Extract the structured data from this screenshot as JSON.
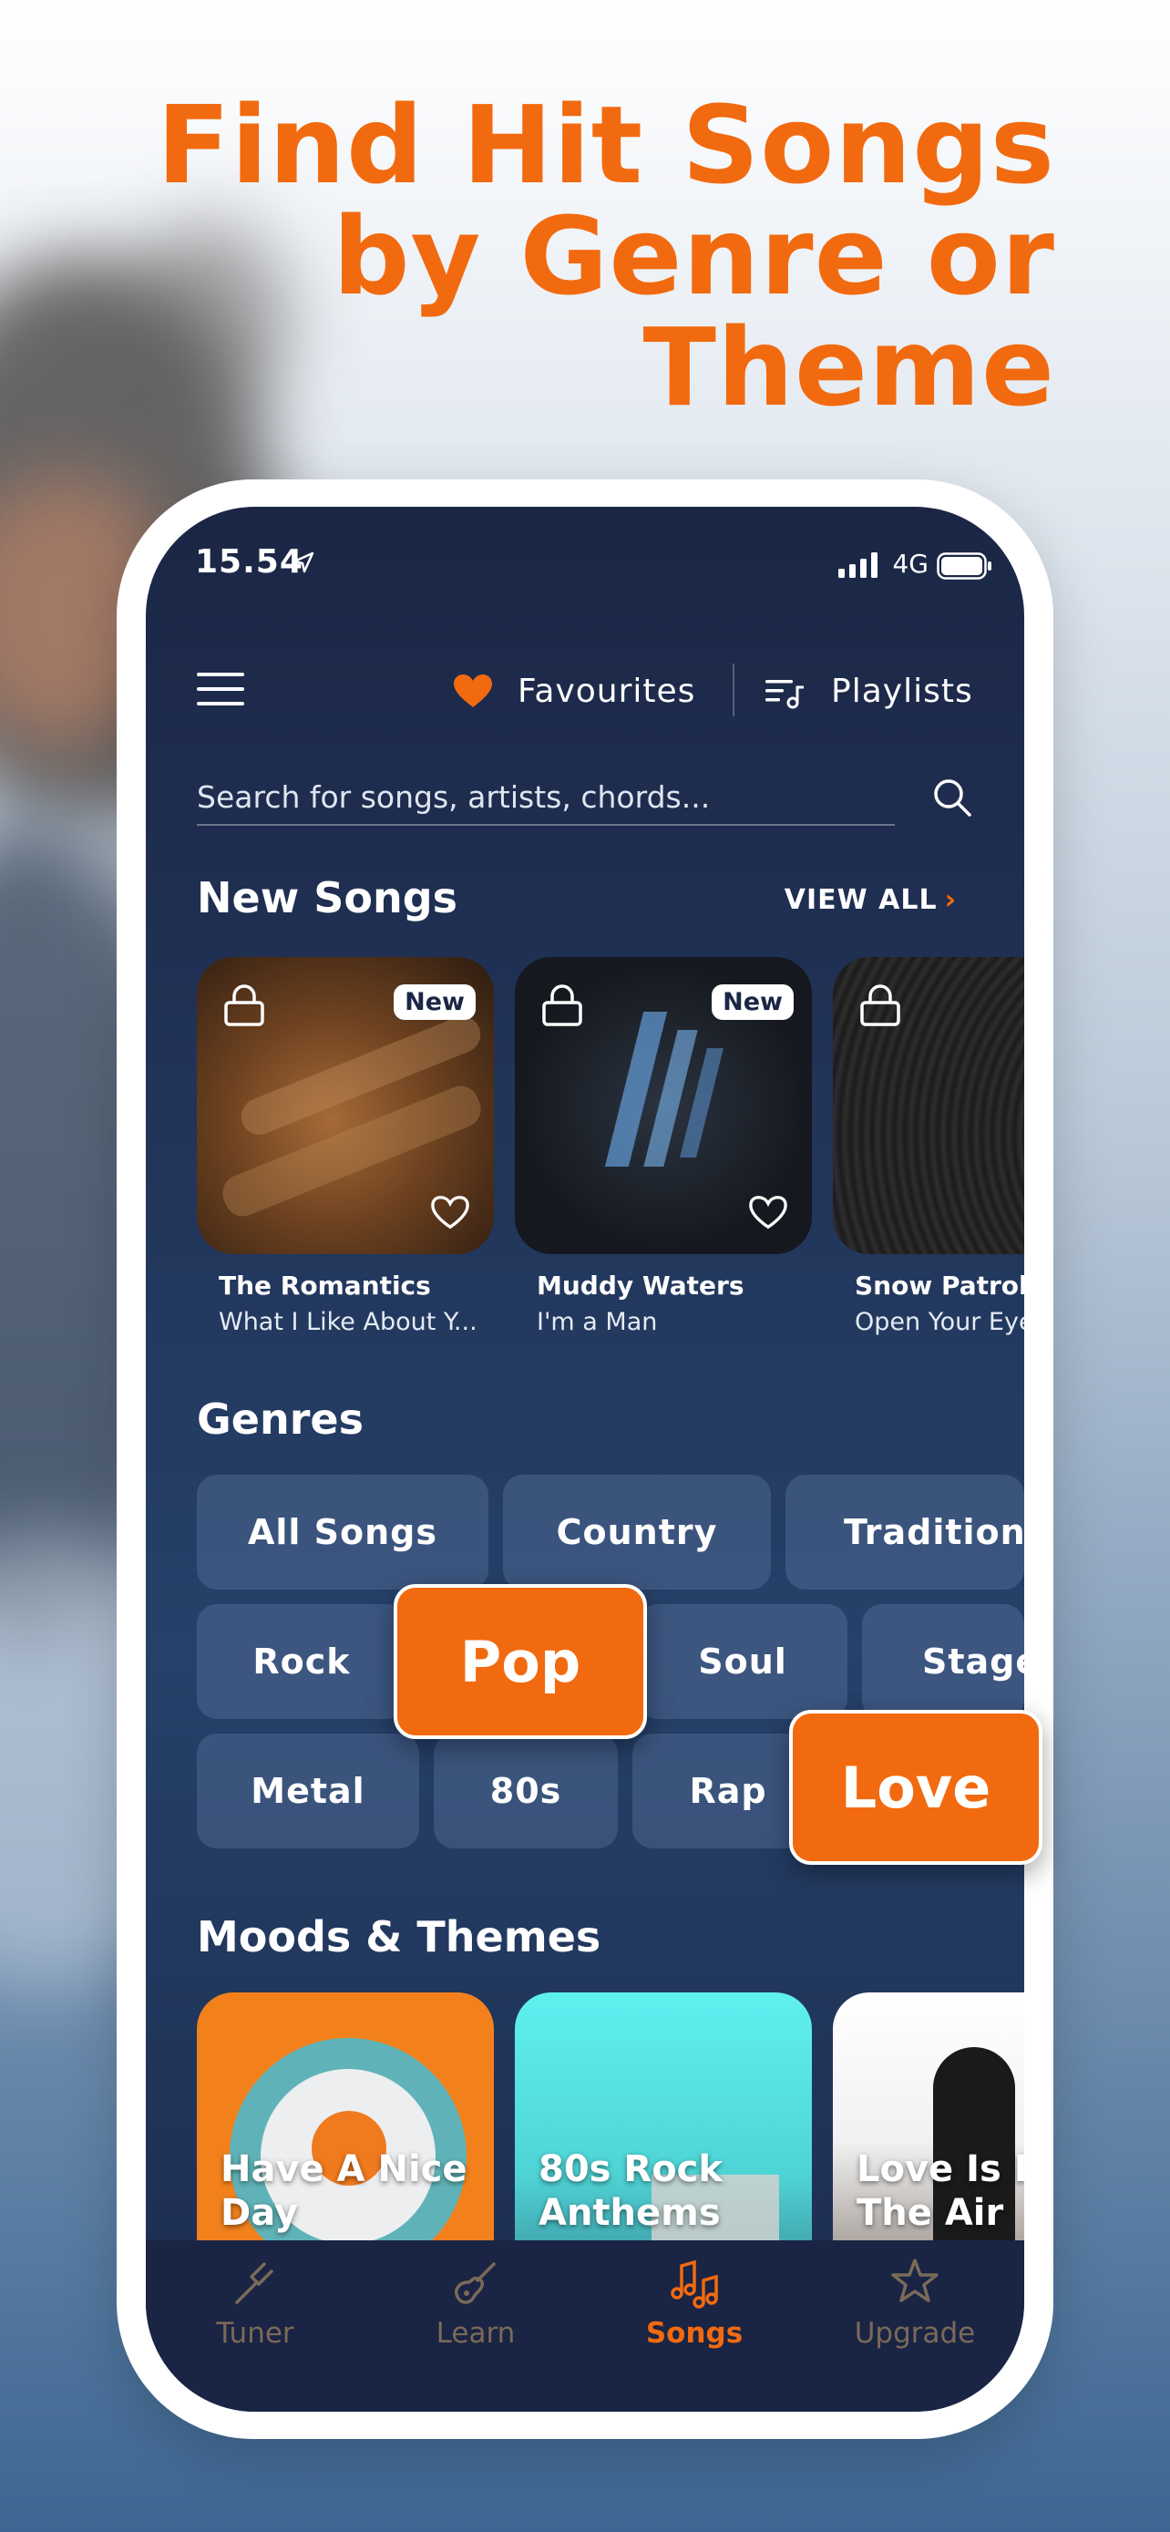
{
  "headline": {
    "line1": "Find Hit Songs",
    "line2": "by Genre or",
    "line3": "Theme"
  },
  "status_bar": {
    "time": "15.54",
    "network": "4G"
  },
  "top_nav": {
    "favourites": "Favourites",
    "playlists": "Playlists"
  },
  "search": {
    "placeholder": "Search for songs, artists, chords..."
  },
  "new_songs": {
    "title": "New Songs",
    "view_all": "VIEW ALL",
    "items": [
      {
        "artist": "The Romantics",
        "song": "What I Like About Y...",
        "badge": "New"
      },
      {
        "artist": "Muddy Waters",
        "song": "I'm a Man",
        "badge": "New"
      },
      {
        "artist": "Snow Patrol",
        "song": "Open Your Eyes"
      }
    ]
  },
  "genres": {
    "title": "Genres",
    "row1": [
      "All Songs",
      "Country",
      "Traditional"
    ],
    "row2": [
      "Rock",
      "Soul",
      "Stage"
    ],
    "row3": [
      "Metal",
      "80s",
      "Rap"
    ],
    "highlight_pop": "Pop",
    "highlight_love": "Love"
  },
  "moods": {
    "title": "Moods & Themes",
    "items": [
      {
        "label": "Have A Nice Day"
      },
      {
        "label": "80s Rock Anthems"
      },
      {
        "label": "Love Is In The Air"
      }
    ]
  },
  "tab_bar": {
    "tabs": [
      {
        "label": "Tuner",
        "icon": "tuner-fork-icon"
      },
      {
        "label": "Learn",
        "icon": "guitar-icon"
      },
      {
        "label": "Songs",
        "icon": "music-notes-icon",
        "active": true
      },
      {
        "label": "Upgrade",
        "icon": "star-badge-icon"
      }
    ]
  },
  "colors": {
    "accent": "#f26a0f",
    "screen_bg": "#22355a",
    "chip_bg": "#3a4f74"
  }
}
